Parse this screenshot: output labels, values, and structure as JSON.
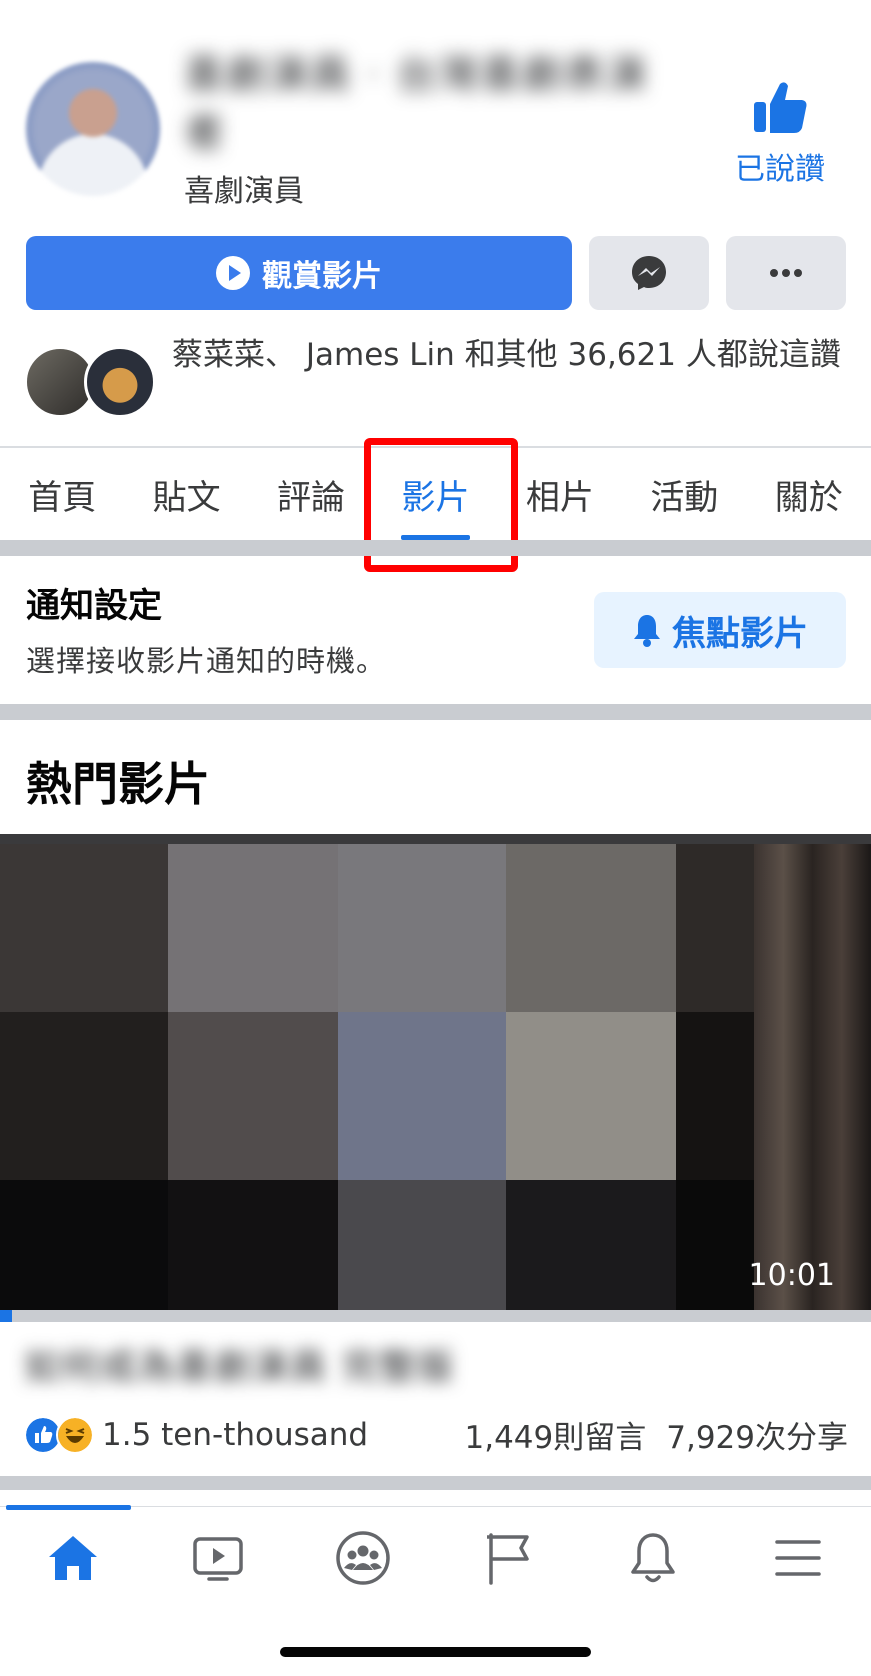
{
  "header": {
    "page_name": "喜劇演員 · 台灣喜劇表演者",
    "category": "喜劇演員",
    "liked_label": "已說讚"
  },
  "actions": {
    "watch_label": "觀賞影片"
  },
  "friends_likes": "蔡菜菜、 James Lin 和其他 36,621 人都說這讚",
  "tabs": [
    {
      "label": "首頁",
      "active": false
    },
    {
      "label": "貼文",
      "active": false
    },
    {
      "label": "評論",
      "active": false
    },
    {
      "label": "影片",
      "active": true
    },
    {
      "label": "相片",
      "active": false
    },
    {
      "label": "活動",
      "active": false
    },
    {
      "label": "關於",
      "active": false
    }
  ],
  "notifications": {
    "title": "通知設定",
    "description": "選擇接收影片通知的時機。",
    "focus_button": "焦點影片"
  },
  "popular": {
    "title": "熱門影片",
    "video": {
      "duration": "10:01",
      "title": "如何成為喜劇演員 完整版",
      "likes": "1.5 ten-thousand",
      "comments": "1,449則留言",
      "shares": "7,929次分享"
    }
  },
  "bottom_nav": [
    {
      "icon": "home-icon",
      "active": true
    },
    {
      "icon": "watch-icon",
      "active": false
    },
    {
      "icon": "groups-icon",
      "active": false
    },
    {
      "icon": "pages-flag-icon",
      "active": false
    },
    {
      "icon": "notifications-bell-icon",
      "active": false
    },
    {
      "icon": "menu-icon",
      "active": false
    }
  ],
  "colors": {
    "accent": "#1b74e4",
    "watch_button": "#3b7cec",
    "highlight_box": "#ff0000"
  }
}
